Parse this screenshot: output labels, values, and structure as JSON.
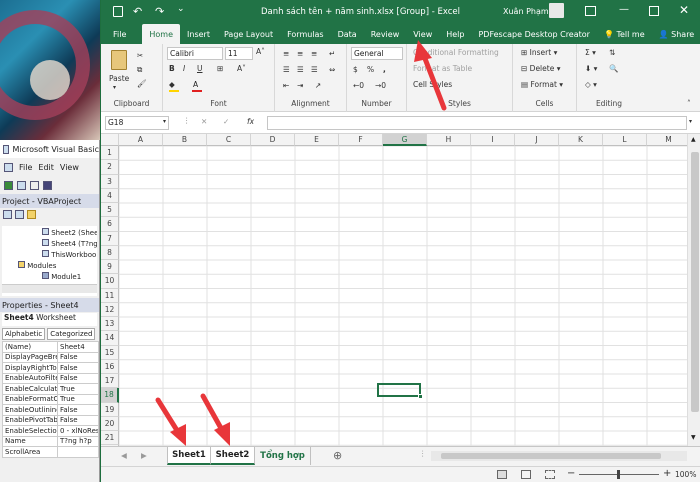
{
  "window": {
    "title": "Danh sách tên + năm sinh.xlsx  [Group]  -  Excel",
    "user": "Xuân Phạm"
  },
  "ribbon_tabs": [
    "File",
    "Home",
    "Insert",
    "Page Layout",
    "Formulas",
    "Data",
    "Review",
    "View",
    "Help",
    "PDFescape Desktop Creator",
    "Tell me",
    "Share"
  ],
  "ribbon": {
    "clipboard": {
      "paste": "Paste",
      "label": "Clipboard"
    },
    "font": {
      "name": "Calibri",
      "size": "11",
      "label": "Font"
    },
    "alignment": {
      "label": "Alignment"
    },
    "number": {
      "format": "General",
      "label": "Number",
      "percent": "%",
      "comma": ","
    },
    "styles": {
      "conditional": "Conditional Formatting",
      "table": "Format as Table",
      "cell": "Cell Styles",
      "label": "Styles"
    },
    "cells": {
      "insert": "Insert",
      "delete": "Delete",
      "format": "Format",
      "label": "Cells"
    },
    "editing": {
      "label": "Editing"
    }
  },
  "formula_bar": {
    "namebox": "G18",
    "fx": "fx",
    "formula": ""
  },
  "columns": [
    "A",
    "B",
    "C",
    "D",
    "E",
    "F",
    "G",
    "H",
    "I",
    "J",
    "K",
    "L",
    "M"
  ],
  "rows": [
    "1",
    "2",
    "3",
    "4",
    "5",
    "6",
    "7",
    "8",
    "9",
    "10",
    "11",
    "12",
    "13",
    "14",
    "15",
    "16",
    "17",
    "18",
    "19",
    "20",
    "21",
    "22"
  ],
  "sheet_tabs": [
    "Sheet1",
    "Sheet2",
    "Tổng hợp"
  ],
  "status": {
    "zoom": "100%"
  },
  "vba": {
    "title": "Microsoft Visual Basic",
    "menu": [
      "File",
      "Edit",
      "View"
    ],
    "project_title": "Project - VBAProject",
    "tree": [
      "Sheet2 (Shee",
      "Sheet4 (T?ng",
      "ThisWorkboo",
      "Modules",
      "Module1"
    ],
    "properties_title": "Properties - Sheet4",
    "object": "Sheet4",
    "object_type": "Worksheet",
    "prop_tabs": [
      "Alphabetic",
      "Categorized"
    ],
    "props": [
      {
        "name": "(Name)",
        "value": "Sheet4"
      },
      {
        "name": "DisplayPageBrea",
        "value": "False"
      },
      {
        "name": "DisplayRightToL",
        "value": "False"
      },
      {
        "name": "EnableAutoFilte",
        "value": "False"
      },
      {
        "name": "EnableCalculatio",
        "value": "True"
      },
      {
        "name": "EnableFormatCo",
        "value": "True"
      },
      {
        "name": "EnableOutlining",
        "value": "False"
      },
      {
        "name": "EnablePivotTabl",
        "value": "False"
      },
      {
        "name": "EnableSelection",
        "value": "0 - xlNoRes"
      },
      {
        "name": "Name",
        "value": "T?ng h?p"
      },
      {
        "name": "ScrollArea",
        "value": ""
      }
    ]
  },
  "colors": {
    "excel_green": "#217346",
    "arrow": "#e8363a",
    "grid": "#e1e1e1"
  }
}
